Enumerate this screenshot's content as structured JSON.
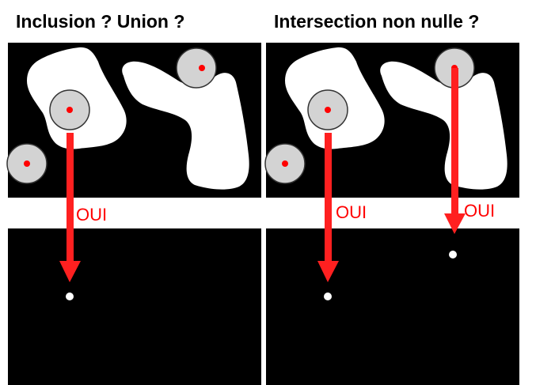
{
  "titles": {
    "left": "Inclusion ? Union ?",
    "right": "Intersection non nulle ?"
  },
  "annotations": {
    "oui": "OUI"
  },
  "colors": {
    "background": "#ffffff",
    "panel": "#000000",
    "shape": "#ffffff",
    "probe_disc": "#d3d3d3",
    "probe_center": "#ff0000",
    "arrow": "#ff2020",
    "result_point": "#ffffff"
  }
}
